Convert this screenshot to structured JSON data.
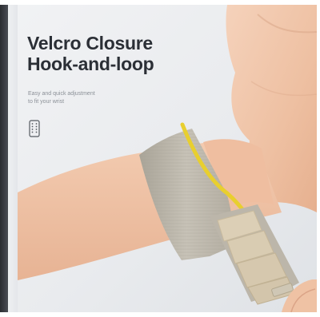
{
  "headline": {
    "line1": "Velcro Closure",
    "line2": "Hook-and-loop"
  },
  "subcopy": {
    "line1": "Easy and quick adjustment",
    "line2": "to fit your wrist"
  },
  "icons": {
    "feature_icon": "velcro-strip-icon"
  },
  "colors": {
    "background": "#eceef1",
    "strap": "#bdb8ad",
    "strap_edge": "#e8cf2f",
    "tab": "#d7cbb3",
    "skin": "#f0c4a7"
  }
}
